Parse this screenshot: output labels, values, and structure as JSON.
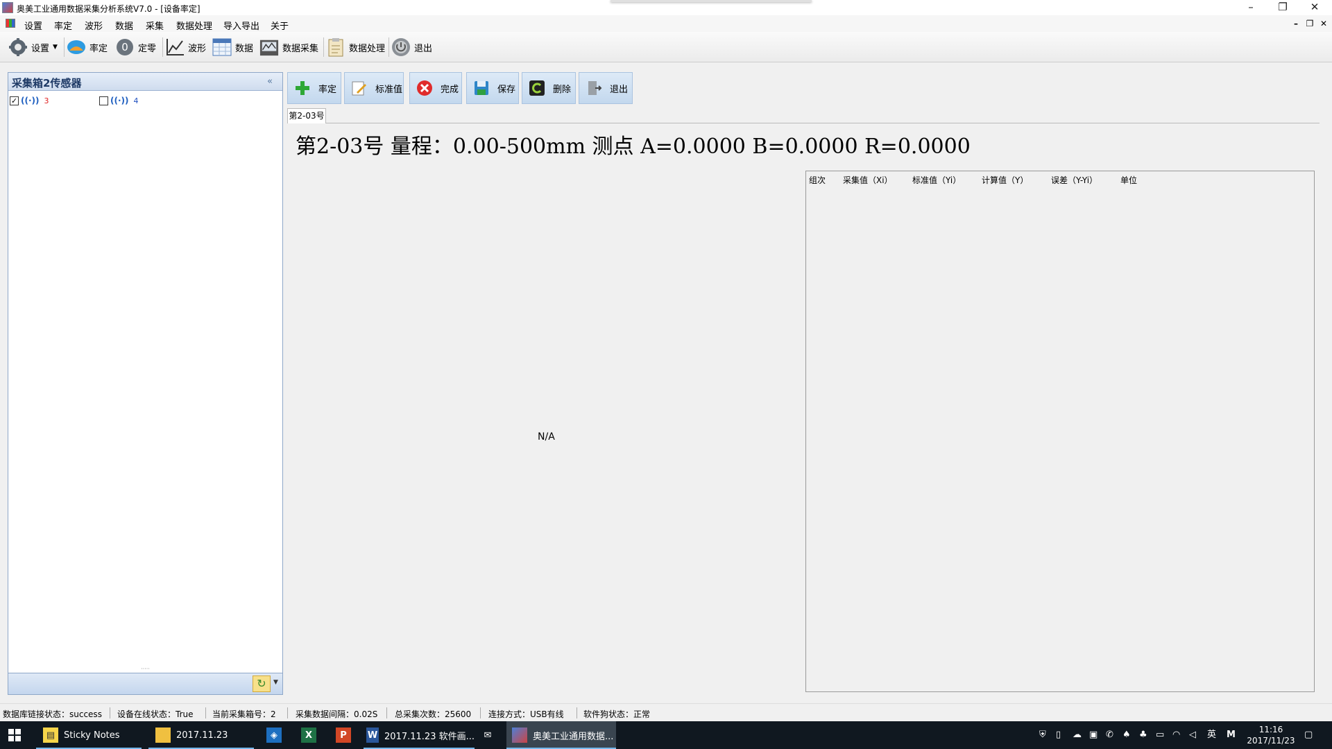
{
  "window": {
    "title": "奥美工业通用数据采集分析系统V7.0 - [设备率定]",
    "minimize": "–",
    "restore": "❐",
    "close": "✕",
    "mdi_minimize": "–",
    "mdi_restore": "❐",
    "mdi_close": "✕"
  },
  "menu": [
    "设置",
    "率定",
    "波形",
    "数据",
    "采集",
    "数据处理",
    "导入导出",
    "关于"
  ],
  "toolbar": {
    "settings": "设置",
    "calibrate": "率定",
    "zero": "定零",
    "waveform": "波形",
    "data": "数据",
    "acquire": "数据采集",
    "process": "数据处理",
    "exit": "退出"
  },
  "sidebar": {
    "title": "采集箱2传感器",
    "collapse": "«",
    "sensors": [
      {
        "label": "3",
        "checked": true,
        "color": "#e02020"
      },
      {
        "label": "4",
        "checked": false,
        "color": "#2050c0"
      }
    ],
    "split_handle": "·····"
  },
  "actions": {
    "calibrate": "率定",
    "standard": "标准值",
    "finish": "完成",
    "save": "保存",
    "delete": "删除",
    "exit": "退出"
  },
  "tab": "第2-03号",
  "headline": "第2-03号  量程：0.00-500mm  测点  A=0.0000  B=0.0000  R=0.0000",
  "chart_placeholder": "N/A",
  "table": {
    "columns": [
      "组次",
      "采集值（Xi）",
      "标准值（Yi）",
      "计算值（Y）",
      "误差（Y-Yi）",
      "单位"
    ],
    "rows": []
  },
  "status": [
    "数据库链接状态：success",
    "设备在线状态：True",
    "当前采集箱号：2",
    "采集数据间隔：0.02S",
    "总采集次数：25600",
    "连接方式：USB有线",
    "软件狗状态：正常"
  ],
  "taskbar": {
    "sticky_notes": "Sticky Notes",
    "folder": "2017.11.23",
    "word": "2017.11.23 软件画...",
    "app": "奥美工业通用数据...",
    "ime": "英",
    "time": "11:16",
    "date": "2017/11/23"
  },
  "colors": {
    "accent": "#4a78b8",
    "panel_header": "#1e3a66",
    "taskbar": "#101820"
  }
}
